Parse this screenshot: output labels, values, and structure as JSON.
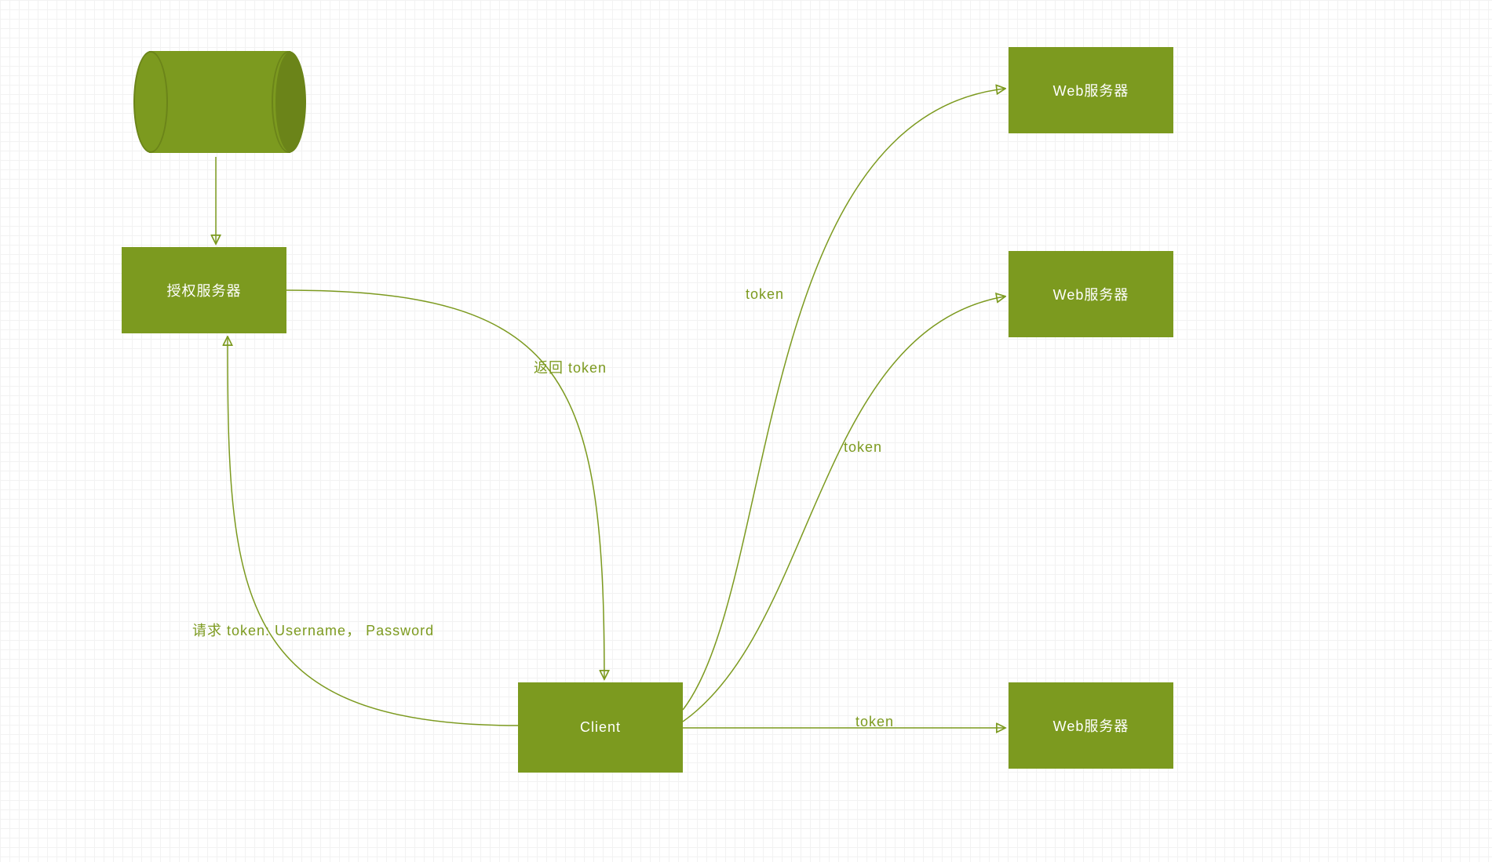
{
  "colors": {
    "primary": "#7c9a1f",
    "primaryDark": "#6b8419",
    "grid": "#f2f2f2"
  },
  "nodes": {
    "database": {
      "type": "cylinder"
    },
    "authServer": {
      "label": "授权服务器"
    },
    "client": {
      "label": "Client"
    },
    "webServer1": {
      "label": "Web服务器"
    },
    "webServer2": {
      "label": "Web服务器"
    },
    "webServer3": {
      "label": "Web服务器"
    }
  },
  "edges": {
    "dbToAuth": {
      "label": ""
    },
    "authToClient": {
      "label": "返回 token"
    },
    "clientToAuth": {
      "label": "请求 token: Username， Password"
    },
    "clientToWeb1": {
      "label": "token"
    },
    "clientToWeb2": {
      "label": "token"
    },
    "clientToWeb3": {
      "label": "token"
    }
  }
}
